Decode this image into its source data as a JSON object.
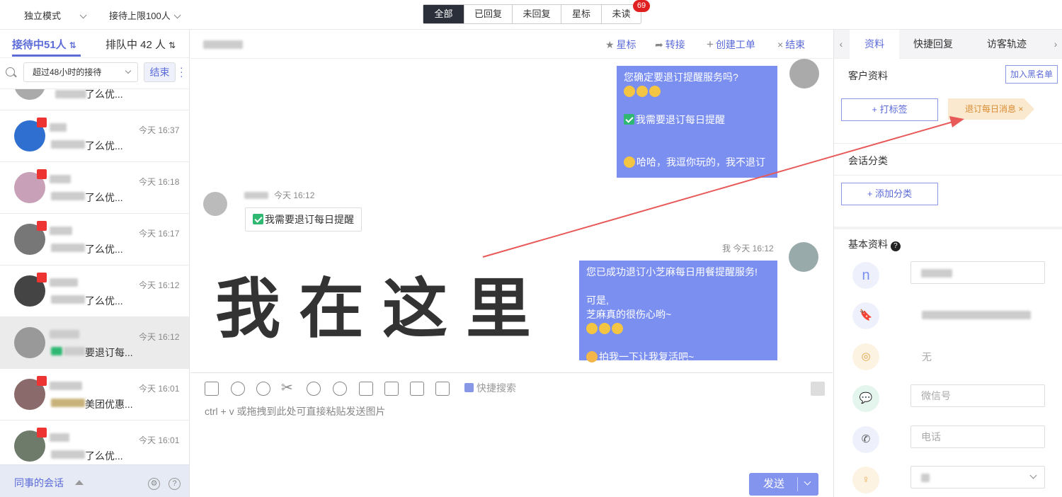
{
  "topbar": {
    "mode": "独立模式",
    "limit": "接待上限100人",
    "filters": [
      "全部",
      "已回复",
      "未回复",
      "星标",
      "未读"
    ],
    "unread_count": "69"
  },
  "left": {
    "tab_active": "接待中51人",
    "tab_queue": "排队中 42 人",
    "filter_select": "超过48小时的接待",
    "end_button": "结束",
    "conversations": [
      {
        "time": "",
        "snippet": "了么优..."
      },
      {
        "time": "今天 16:37",
        "snippet": "了么优..."
      },
      {
        "time": "今天 16:18",
        "snippet": "了么优..."
      },
      {
        "time": "今天 16:17",
        "snippet": "了么优..."
      },
      {
        "time": "今天 16:12",
        "snippet": "了么优..."
      },
      {
        "time": "今天 16:12",
        "snippet": "要退订每..."
      },
      {
        "time": "今天 16:01",
        "snippet": "美团优惠..."
      },
      {
        "time": "今天 16:01",
        "snippet": "了么优..."
      }
    ],
    "footer": "同事的会话"
  },
  "chat_header": {
    "star": "星标",
    "transfer": "转接",
    "create_ticket": "创建工单",
    "end": "结束"
  },
  "messages": {
    "m1": [
      "您确定要退订提醒服务吗?",
      "",
      "",
      "我需要退订每日提醒",
      "",
      "",
      "哈哈，我逗你玩的，我不退订"
    ],
    "visitor_time": "今天 16:12",
    "visitor_msg": "我需要退订每日提醒",
    "agent_meta": "我  今天 16:12",
    "m2": [
      "您已成功退订小芝麻每日用餐提醒服务!",
      "",
      "可是,",
      "芝麻真的很伤心哟~",
      "",
      "",
      "拍我一下让我复活吧~"
    ]
  },
  "overlay_text": "我在这里",
  "composer": {
    "quick_search": "快捷搜索",
    "placeholder": "ctrl + v 或拖拽到此处可直接粘贴发送图片",
    "send": "发送"
  },
  "right": {
    "tabs": [
      "资料",
      "快捷回复",
      "访客轨迹"
    ],
    "customer_info": "客户资料",
    "blacklist": "加入黑名单",
    "add_tag": "+ 打标签",
    "tag": "退订每日消息 ×",
    "session_category": "会话分类",
    "add_category": "+ 添加分类",
    "basic_info": "基本资料",
    "location_value": "无",
    "wechat_placeholder": "微信号",
    "phone_placeholder": "电话"
  },
  "colors": {
    "accent": "#5b6bd8",
    "bubble": "#7b8ff0",
    "arrow": "#e85a5a"
  }
}
